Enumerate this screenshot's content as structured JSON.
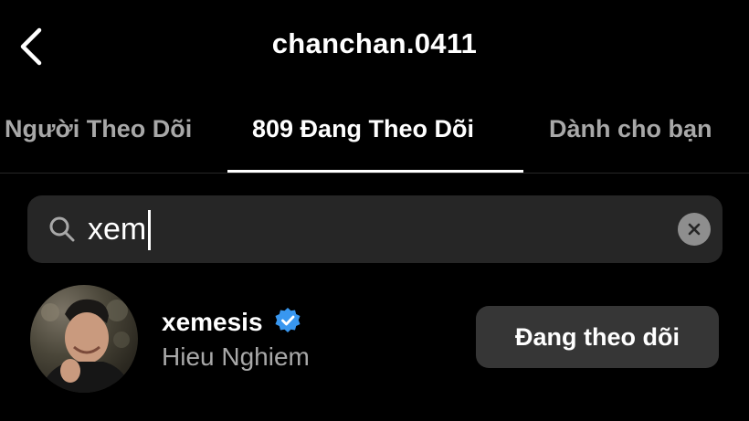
{
  "header": {
    "title": "chanchan.0411",
    "back_icon": "chevron-left-icon"
  },
  "tabs": [
    {
      "label": "Người Theo Dõi",
      "active": false
    },
    {
      "label": "809 Đang Theo Dõi",
      "active": true
    },
    {
      "label": "Dành cho bạn",
      "active": false
    }
  ],
  "search": {
    "value": "xem",
    "icon": "search-icon",
    "clear_icon": "clear-icon"
  },
  "results": [
    {
      "username": "xemesis",
      "verified": true,
      "full_name": "Hieu Nghiem",
      "button_label": "Đang theo dõi"
    }
  ],
  "colors": {
    "background": "#000000",
    "search_bg": "#262626",
    "button_bg": "#363636",
    "secondary_text": "#a8a8a8",
    "verified_blue": "#3897f0"
  }
}
